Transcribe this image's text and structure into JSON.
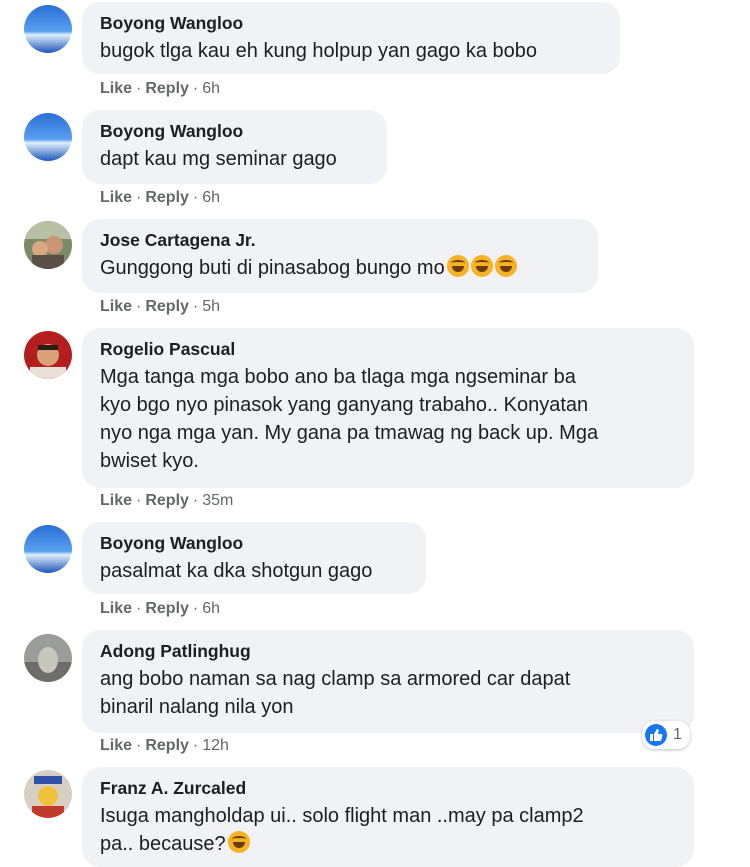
{
  "comments": [
    {
      "author": "Boyong Wangloo",
      "lines": [
        "bugok tlga kau eh kung holpup yan gago ka bobo"
      ],
      "like": "Like",
      "reply": "Reply",
      "time": "6h",
      "avatar": "sky-avatar"
    },
    {
      "author": "Boyong Wangloo",
      "lines": [
        "dapt kau mg seminar gago"
      ],
      "like": "Like",
      "reply": "Reply",
      "time": "6h",
      "avatar": "sky-avatar"
    },
    {
      "author": "Jose Cartagena Jr.",
      "lines": [
        "Gunggong buti di pinasabog bungo mo"
      ],
      "emoji_count": 3,
      "like": "Like",
      "reply": "Reply",
      "time": "5h",
      "avatar": "photo-avatar"
    },
    {
      "author": "Rogelio Pascual",
      "lines": [
        "Mga tanga mga bobo ano ba tlaga mga ngseminar ba",
        "kyo bgo nyo pinasok yang ganyang trabaho.. Konyatan",
        "nyo nga mga yan. My gana pa tmawag ng back up. Mga",
        "bwiset kyo."
      ],
      "like": "Like",
      "reply": "Reply",
      "time": "35m",
      "avatar": "photo-avatar"
    },
    {
      "author": "Boyong Wangloo",
      "lines": [
        "pasalmat ka dka shotgun gago"
      ],
      "like": "Like",
      "reply": "Reply",
      "time": "6h",
      "avatar": "sky-avatar"
    },
    {
      "author": "Adong Patlinghug",
      "lines": [
        "ang bobo naman sa nag clamp sa armored car dapat",
        "binaril nalang nila yon"
      ],
      "like": "Like",
      "reply": "Reply",
      "time": "12h",
      "avatar": "photo-avatar",
      "reaction_count": "1"
    },
    {
      "author": "Franz A. Zurcaled",
      "lines": [
        "Isuga mangholdap ui.. solo flight man ..may pa clamp2",
        "pa.. because?"
      ],
      "like": "Like",
      "reply": "Reply",
      "avatar": "photo-avatar"
    }
  ],
  "colors": {
    "bubble": "#f0f2f5",
    "text": "#1c1e21",
    "meta": "#65676b",
    "like_blue": "#1877f2"
  }
}
